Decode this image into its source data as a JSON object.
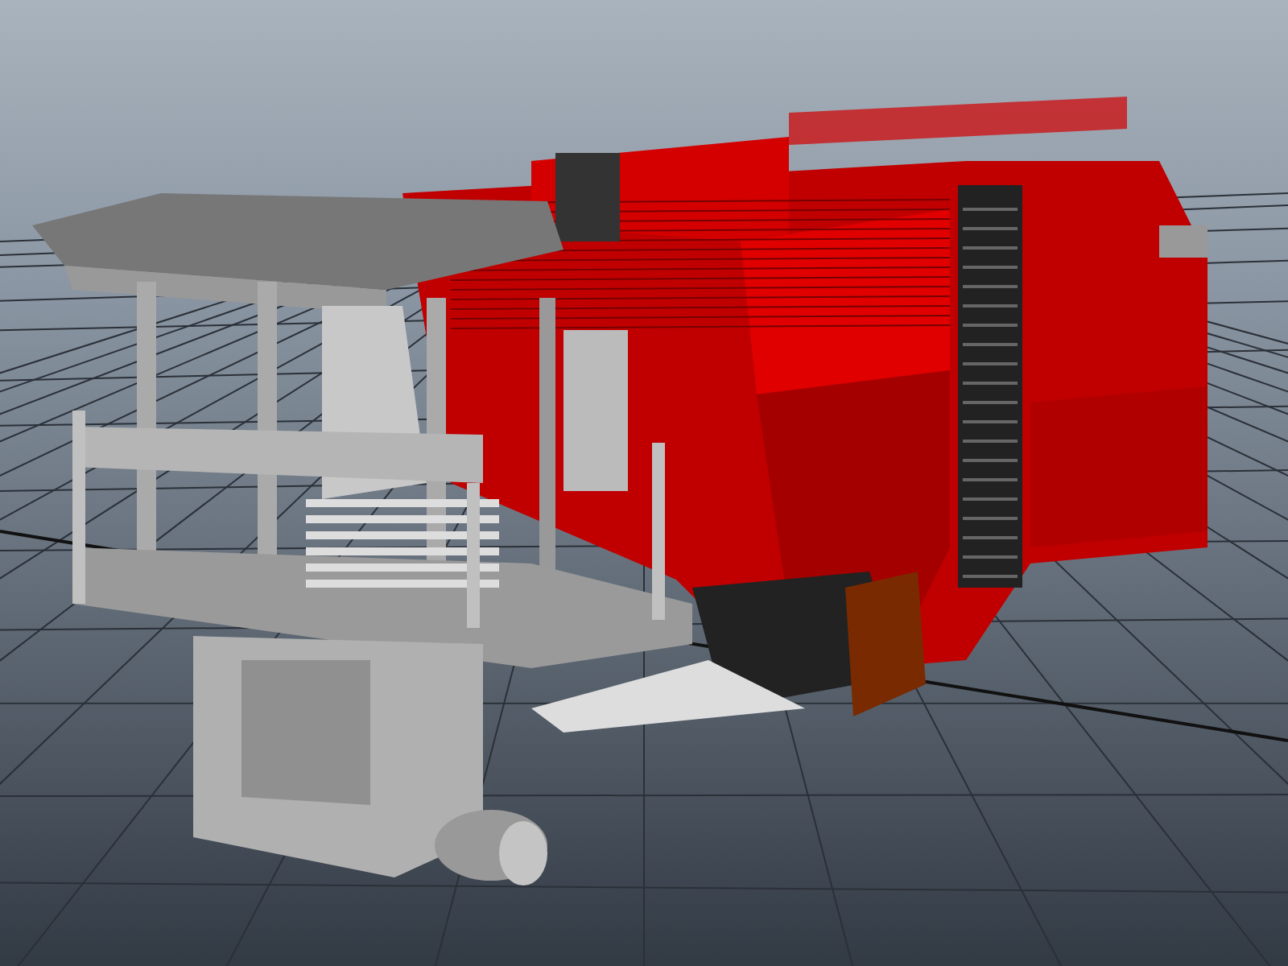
{
  "viewport": {
    "kind": "render"
  }
}
